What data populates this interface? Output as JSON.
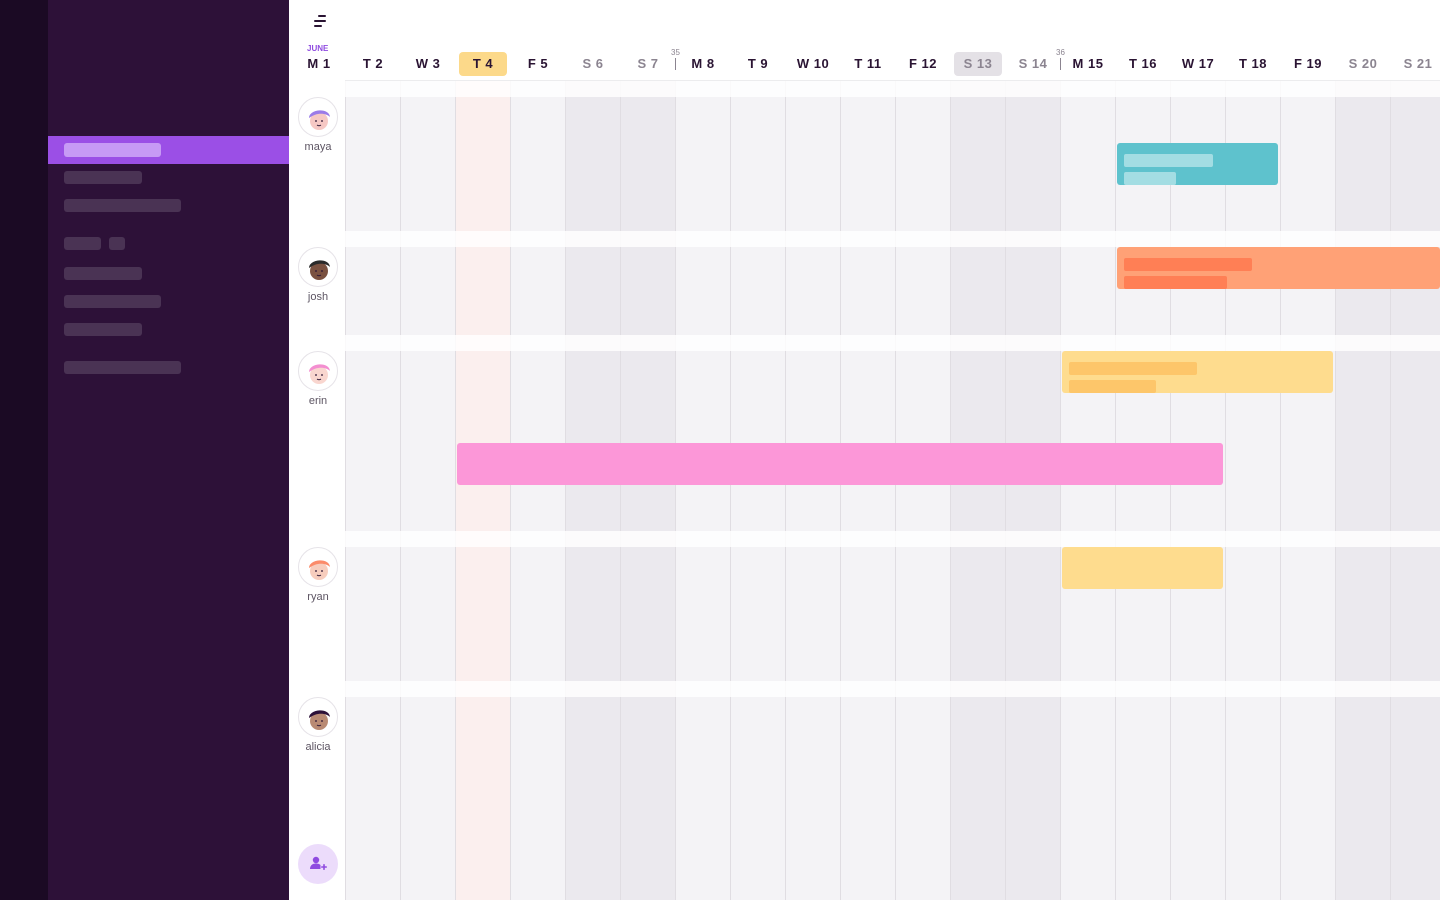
{
  "sidebar": {
    "colors": {
      "rail": "#1b0a24",
      "panel": "#2d1138",
      "active": "#9b4fe6"
    }
  },
  "toolbar": {
    "menu_icon": "filter-lines-icon"
  },
  "calendar": {
    "month": "JUNE",
    "today_label": "T 4",
    "selected_label": "S 13",
    "week_numbers": [
      "35",
      "36"
    ],
    "days": [
      {
        "label": "M 1",
        "weekend": false
      },
      {
        "label": "T 2",
        "weekend": false
      },
      {
        "label": "W 3",
        "weekend": false
      },
      {
        "label": "T 4",
        "weekend": false
      },
      {
        "label": "F 5",
        "weekend": false
      },
      {
        "label": "S 6",
        "weekend": true
      },
      {
        "label": "S 7",
        "weekend": true
      },
      {
        "label": "M 8",
        "weekend": false
      },
      {
        "label": "T 9",
        "weekend": false
      },
      {
        "label": "W 10",
        "weekend": false
      },
      {
        "label": "T 11",
        "weekend": false
      },
      {
        "label": "F 12",
        "weekend": false
      },
      {
        "label": "S 13",
        "weekend": true
      },
      {
        "label": "S 14",
        "weekend": true
      },
      {
        "label": "M 15",
        "weekend": false
      },
      {
        "label": "T 16",
        "weekend": false
      },
      {
        "label": "W 17",
        "weekend": false
      },
      {
        "label": "T 18",
        "weekend": false
      },
      {
        "label": "F 19",
        "weekend": false
      },
      {
        "label": "S 20",
        "weekend": true
      },
      {
        "label": "S 21",
        "weekend": true
      }
    ]
  },
  "people": [
    {
      "name": "maya",
      "hair": "#9b7be8",
      "skin": "#f6c8c4"
    },
    {
      "name": "josh",
      "hair": "#2b2b2b",
      "skin": "#7a5140"
    },
    {
      "name": "erin",
      "hair": "#f38ed0",
      "skin": "#f9d6cf"
    },
    {
      "name": "ryan",
      "hair": "#fb8b6a",
      "skin": "#f7cdbd"
    },
    {
      "name": "alicia",
      "hair": "#2d1138",
      "skin": "#b98a73"
    }
  ],
  "assignments": [
    {
      "person": "maya",
      "start": "T 16",
      "end": "T 18",
      "color": "#5ec2cd",
      "placeholder": "#a3dde3"
    },
    {
      "person": "josh",
      "start": "T 16",
      "end": "S 21",
      "color": "#ffa176",
      "placeholder": "#ff7f55"
    },
    {
      "person": "erin",
      "start": "M 15",
      "end": "F 19",
      "color": "#fedc8e",
      "placeholder": "#fdc66a"
    },
    {
      "person": "erin",
      "start": "T 4",
      "end": "W 17",
      "color": "#fc97d8",
      "placeholder": ""
    },
    {
      "person": "ryan",
      "start": "M 15",
      "end": "W 17",
      "color": "#fedc8e",
      "placeholder": ""
    }
  ],
  "actions": {
    "add_person_icon": "add-person-icon"
  }
}
